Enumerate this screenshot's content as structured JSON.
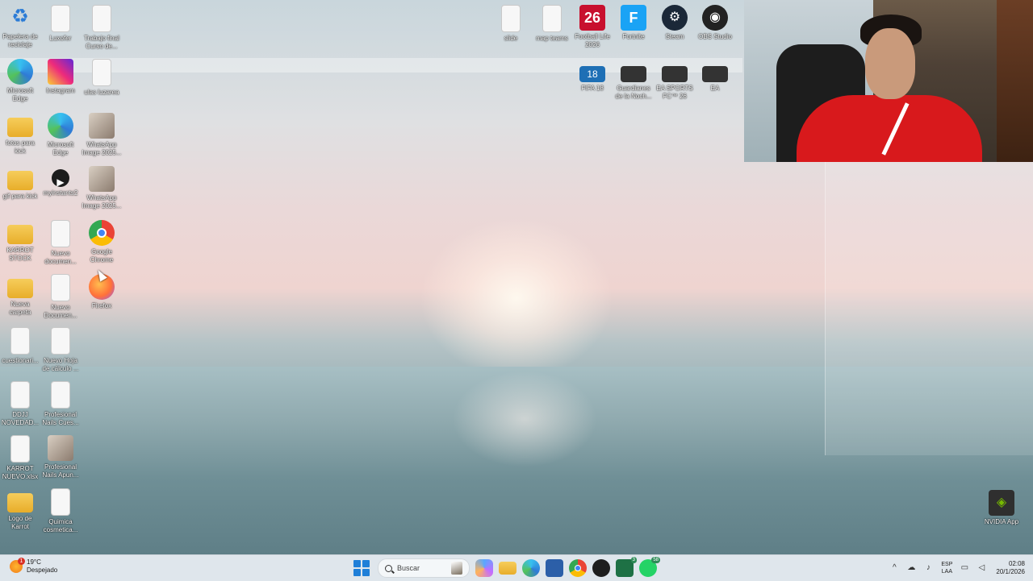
{
  "desktop": {
    "icons_left": [
      {
        "label": "Papelera de reciclaje",
        "icon": "recycle-bin-icon"
      },
      {
        "label": "Luxofer",
        "icon": "document-icon"
      },
      {
        "label": "Trabajo final Curso de...",
        "icon": "document-icon"
      },
      {
        "label": "Microsoft Edge",
        "icon": "edge-icon"
      },
      {
        "label": "Instagram",
        "icon": "instagram-icon"
      },
      {
        "label": "ulas luzarea",
        "icon": "document-icon"
      },
      {
        "label": "fotos para kick",
        "icon": "folder-icon"
      },
      {
        "label": "Microsoft Edge",
        "icon": "edge-icon"
      },
      {
        "label": "WhatsApp Image 2025...",
        "icon": "image-icon"
      },
      {
        "label": "gif para kick",
        "icon": "folder-icon"
      },
      {
        "label": "myinstants2",
        "icon": "media-icon"
      },
      {
        "label": "WhatsApp Image 2025...",
        "icon": "image-icon"
      },
      {
        "label": "KARROT STOCK",
        "icon": "folder-icon"
      },
      {
        "label": "Nuevo documen...",
        "icon": "document-icon"
      },
      {
        "label": "Google Chrome",
        "icon": "chrome-icon"
      },
      {
        "label": "Nueva carpeta",
        "icon": "folder-icon"
      },
      {
        "label": "Nuevo Documen...",
        "icon": "document-icon"
      },
      {
        "label": "Firefox",
        "icon": "firefox-icon"
      },
      {
        "label": "cuestionari...",
        "icon": "document-icon"
      },
      {
        "label": "Nuevo Hoja de cálculo ...",
        "icon": "spreadsheet-icon"
      },
      {
        "label": "DDJJ NOVEDAD...",
        "icon": "document-icon"
      },
      {
        "label": "Profesional Nails Cues...",
        "icon": "document-icon"
      },
      {
        "label": "KARROT NUEVO.xlsx",
        "icon": "document-icon"
      },
      {
        "label": "Profesional Nails Apun...",
        "icon": "image-icon"
      },
      {
        "label": "Logo de Karrot",
        "icon": "folder-icon"
      },
      {
        "label": "Quimica cosmetica...",
        "icon": "document-icon"
      }
    ],
    "icons_top": [
      {
        "label": "slide",
        "icon": "document-icon"
      },
      {
        "label": "map teams",
        "icon": "document-icon"
      },
      {
        "label": "Football Life 2026",
        "icon": "game26-icon",
        "glyph": "26"
      },
      {
        "label": "Fortnite",
        "icon": "fortnite-icon",
        "glyph": "F"
      },
      {
        "label": "Steam",
        "icon": "steam-icon",
        "glyph": "⚙"
      },
      {
        "label": "OBS Studio",
        "icon": "obs-icon",
        "glyph": "◉"
      }
    ],
    "icons_top_row2": [
      {
        "label": "FIFA 18",
        "icon": "fifa-icon",
        "glyph": "18"
      },
      {
        "label": "Guardianes de la Noch...",
        "icon": "game-icon",
        "glyph": ""
      },
      {
        "label": "EA SPORTS FC™ 26",
        "icon": "game-icon",
        "glyph": ""
      },
      {
        "label": "EA",
        "icon": "game-icon",
        "glyph": ""
      }
    ],
    "nvidia": {
      "label": "NVIDIA App",
      "glyph": "◈"
    }
  },
  "taskbar": {
    "weather_temp": "19°C",
    "weather_desc": "Despejado",
    "weather_badge": "1",
    "search_placeholder": "Buscar",
    "apps": [
      "copilot",
      "file-explorer",
      "edge",
      "microsoft-store",
      "chrome",
      "obs",
      "excel",
      "whatsapp"
    ],
    "excel_badge": "3",
    "whatsapp_badge": "58",
    "lang_top": "ESP",
    "lang_bottom": "LAA",
    "time": "02:08",
    "date": "20/1/2026",
    "colors": {
      "taskbar": "#dfe6ec",
      "start": "#1f7fd8"
    }
  }
}
